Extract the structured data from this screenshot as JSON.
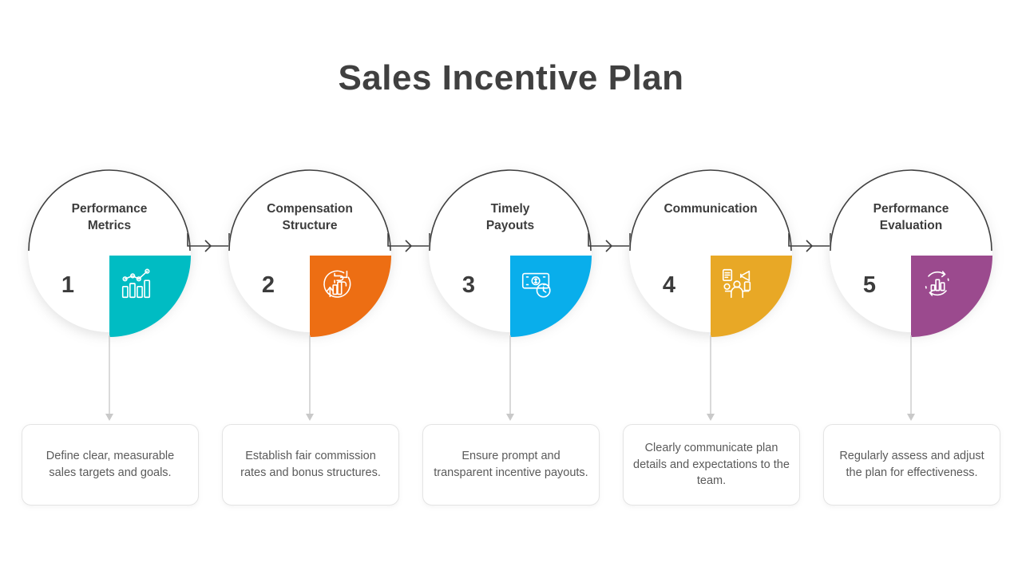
{
  "title": "Sales Incentive Plan",
  "theme": {
    "title_color": "#404040",
    "label_color": "#3c3c3c",
    "body_color": "#5a5a5a",
    "arc_color": "#3f3f3f",
    "card_border": "#e4e4e4",
    "stem_color": "#c9c9c9",
    "background": "#ffffff"
  },
  "steps": [
    {
      "number": "1",
      "label": "Performance\nMetrics",
      "label_line1": "Performance",
      "label_line2": "Metrics",
      "color": "#00bcc3",
      "icon": "bar-chart-growth-icon",
      "description": "Define clear, measurable sales targets and goals."
    },
    {
      "number": "2",
      "label": "Compensation\nStructure",
      "label_line1": "Compensation",
      "label_line2": "Structure",
      "color": "#ed6e13",
      "icon": "hand-money-growth-icon",
      "description": "Establish fair commission rates and bonus structures."
    },
    {
      "number": "3",
      "label": "Timely\nPayouts",
      "label_line1": "Timely",
      "label_line2": "Payouts",
      "color": "#09aeeb",
      "icon": "cash-clock-icon",
      "description": "Ensure prompt and transparent incentive payouts."
    },
    {
      "number": "4",
      "label": "Communication",
      "label_line1": "Communication",
      "label_line2": "",
      "color": "#e8a826",
      "icon": "person-megaphone-icon",
      "description": "Clearly communicate plan details and expectations to the team."
    },
    {
      "number": "5",
      "label": "Performance\nEvaluation",
      "label_line1": "Performance",
      "label_line2": "Evaluation",
      "color": "#9b4a8e",
      "icon": "chart-refresh-cycle-icon",
      "description": "Regularly assess and adjust the plan for effectiveness."
    }
  ]
}
